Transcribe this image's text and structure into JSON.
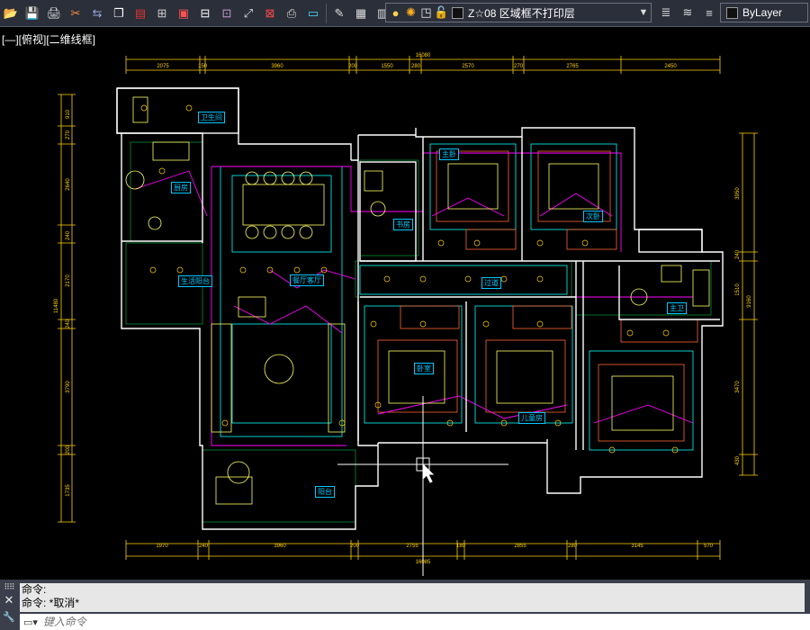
{
  "toolbar": {
    "buttons": [
      {
        "icon": "open-folder-icon",
        "glyph": "📂"
      },
      {
        "icon": "save-icon",
        "glyph": "💾"
      },
      {
        "icon": "print-icon",
        "glyph": "🖨"
      },
      {
        "icon": "cut-icon",
        "glyph": "✂"
      },
      {
        "icon": "match-properties-icon",
        "glyph": "⇆"
      },
      {
        "icon": "copy-icon",
        "glyph": "❐"
      },
      {
        "icon": "layer-tools-icon",
        "glyph": "▤"
      },
      {
        "icon": "block-icon",
        "glyph": "⊞"
      },
      {
        "icon": "region-icon",
        "glyph": "▣"
      },
      {
        "icon": "mirror-icon",
        "glyph": "⊟"
      },
      {
        "icon": "array-icon",
        "glyph": "⊡"
      },
      {
        "icon": "stretch-icon",
        "glyph": "⤢"
      },
      {
        "icon": "delete-icon",
        "glyph": "⊠"
      },
      {
        "icon": "plot-icon",
        "glyph": "⎙"
      },
      {
        "icon": "monitor-icon",
        "glyph": "▭"
      },
      {
        "icon": "edit-icon",
        "glyph": "✎"
      },
      {
        "icon": "calculator-icon",
        "glyph": "▦"
      },
      {
        "icon": "table-icon",
        "glyph": "▥"
      }
    ]
  },
  "layer": {
    "name": "Z☆08 区域框不打印层",
    "icons": [
      "bulb-icon",
      "sun-icon",
      "lock-square-icon",
      "padlock-icon"
    ],
    "swatch_color": "#111111"
  },
  "right_tools": [
    "layer-stack-icon",
    "layer-previous-icon",
    "layer-match-icon"
  ],
  "color_control": {
    "label": "ByLayer"
  },
  "viewport": {
    "label": "[—][俯视][二维线框]"
  },
  "dimensions": {
    "top": [
      "16080",
      "2075",
      "150",
      "3960",
      "200",
      "1550",
      "280",
      "2570",
      "270",
      "2765",
      "2450"
    ],
    "bottom": [
      "16085",
      "1970",
      "240",
      "3960",
      "200",
      "2755",
      "180",
      "2855",
      "280",
      "3145",
      "570"
    ],
    "left": [
      "11480",
      "910",
      "270",
      "2640",
      "240",
      "2170",
      "240",
      "3790",
      "200",
      "1735"
    ],
    "right": [
      "9160",
      "3950",
      "240",
      "1510",
      "3470",
      "430"
    ]
  },
  "rooms": [
    {
      "label": "卫生间",
      "color": "#00c8ff"
    },
    {
      "label": "厨房",
      "color": "#00c8ff"
    },
    {
      "label": "餐厅客厅",
      "color": "#00c8ff"
    },
    {
      "label": "书房",
      "color": "#00c8ff"
    },
    {
      "label": "主卧",
      "color": "#00c8ff"
    },
    {
      "label": "次卧",
      "color": "#00c8ff"
    },
    {
      "label": "卧室",
      "color": "#00c8ff"
    },
    {
      "label": "儿童房",
      "color": "#00c8ff"
    },
    {
      "label": "过道",
      "color": "#00c8ff"
    },
    {
      "label": "阳台",
      "color": "#00c8ff"
    },
    {
      "label": "主卫",
      "color": "#00c8ff"
    },
    {
      "label": "生活阳台",
      "color": "#00c8ff"
    }
  ],
  "command": {
    "history": [
      "命令:",
      "命令:  *取消*"
    ],
    "placeholder": "键入命令"
  },
  "colors": {
    "background": "#000000",
    "wall": "#ffffff",
    "dimension": "#ffd200",
    "furniture": "#ffff66",
    "ceiling": "#00ffff",
    "circuit": "#ff00ff",
    "hatch": "#00ff60",
    "accent": "#ff6633"
  }
}
